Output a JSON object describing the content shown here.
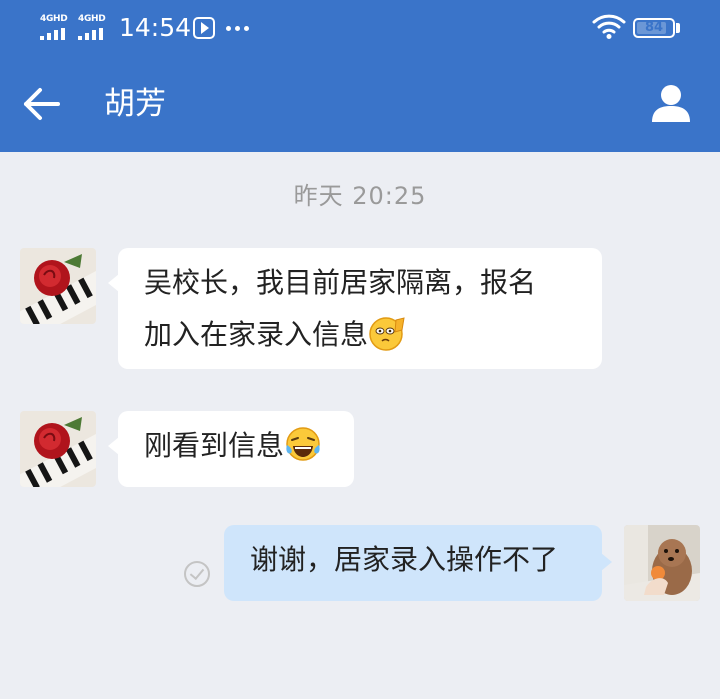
{
  "status_bar": {
    "sim1_network": "4GHD",
    "sim2_network": "4GHD",
    "time": "14:54",
    "battery_level": "84",
    "icons": [
      "signal-icon",
      "media-player-icon",
      "more-dots-icon",
      "wifi-icon",
      "battery-icon"
    ]
  },
  "header": {
    "contact_name": "胡芳",
    "back_icon": "back-arrow-icon",
    "profile_icon": "person-icon"
  },
  "chat": {
    "timestamp": "昨天  20:25",
    "messages": [
      {
        "direction": "incoming",
        "line1": "吴校长，我目前居家隔离，报名",
        "line2": "加入在家录入信息",
        "emoji": "salute-face"
      },
      {
        "direction": "incoming",
        "text": "刚看到信息",
        "emoji": "tears-of-joy"
      },
      {
        "direction": "outgoing",
        "text": "谢谢，居家录入操作不了",
        "status": "read-check-icon"
      }
    ]
  },
  "colors": {
    "header_bg": "#3a74c9",
    "chat_bg": "#eceef3",
    "incoming_bubble": "#ffffff",
    "outgoing_bubble": "#cfe5fb",
    "timestamp_text": "#9a9a9a"
  }
}
